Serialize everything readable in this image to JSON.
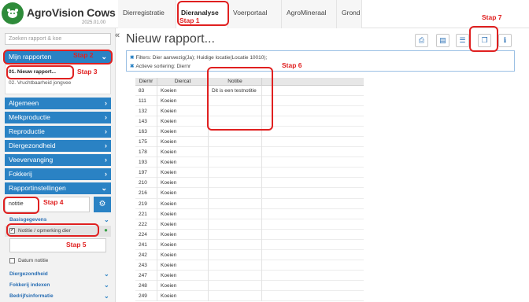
{
  "app": {
    "name": "AgroVision Cows",
    "version": "2025.01.00"
  },
  "tabs": [
    "Dierregistratie",
    "Dieranalyse",
    "Voerportaal",
    "AgroMineraal",
    "Grond"
  ],
  "sidebar": {
    "search_placeholder": "Zoeken rapport & koe",
    "my_reports": "Mijn rapporten",
    "reports": [
      "01. Nieuw rapport...",
      "02. Vruchtbaarheid jongvee"
    ],
    "categories": [
      "Algemeen",
      "Melkproductie",
      "Reproductie",
      "Diergezondheid",
      "Veevervanging",
      "Fokkerij",
      "Rapportinstellingen"
    ],
    "filter_value": "notitie",
    "basis_section": "Basisgegevens",
    "field_checked": "Notitie / opmerking dier",
    "field_unchecked": "Datum notitie",
    "section_links": [
      "Diergezondheid",
      "Fokkerij indexen",
      "Bedrijfsinformatie"
    ]
  },
  "main": {
    "title": "Nieuw rapport...",
    "filters_line": "Filters: Dier aanwezig(Ja);  Huidige locatie(Locatie 10010);",
    "sort_line": "Actieve sortering: Diernr",
    "columns": [
      "Diernr",
      "Diercat",
      "Notitie"
    ],
    "rows": [
      [
        "83",
        "Koeien",
        "Dit is een testnotitie"
      ],
      [
        "111",
        "Koeien",
        ""
      ],
      [
        "132",
        "Koeien",
        ""
      ],
      [
        "143",
        "Koeien",
        ""
      ],
      [
        "163",
        "Koeien",
        ""
      ],
      [
        "175",
        "Koeien",
        ""
      ],
      [
        "178",
        "Koeien",
        ""
      ],
      [
        "193",
        "Koeien",
        ""
      ],
      [
        "197",
        "Koeien",
        ""
      ],
      [
        "210",
        "Koeien",
        ""
      ],
      [
        "216",
        "Koeien",
        ""
      ],
      [
        "219",
        "Koeien",
        ""
      ],
      [
        "221",
        "Koeien",
        ""
      ],
      [
        "222",
        "Koeien",
        ""
      ],
      [
        "224",
        "Koeien",
        ""
      ],
      [
        "241",
        "Koeien",
        ""
      ],
      [
        "242",
        "Koeien",
        ""
      ],
      [
        "243",
        "Koeien",
        ""
      ],
      [
        "247",
        "Koeien",
        ""
      ],
      [
        "248",
        "Koeien",
        ""
      ],
      [
        "249",
        "Koeien",
        ""
      ]
    ]
  },
  "steps": {
    "s1": "Stap 1",
    "s2": "Stap 2",
    "s3": "Stap 3",
    "s4": "Stap 4",
    "s5": "Stap 5",
    "s6": "Stap 6",
    "s7": "Stap 7"
  },
  "colors": {
    "nav_blue": "#2a82c4",
    "annotation_red": "#e02020",
    "brand_green": "#2e8b3a"
  }
}
